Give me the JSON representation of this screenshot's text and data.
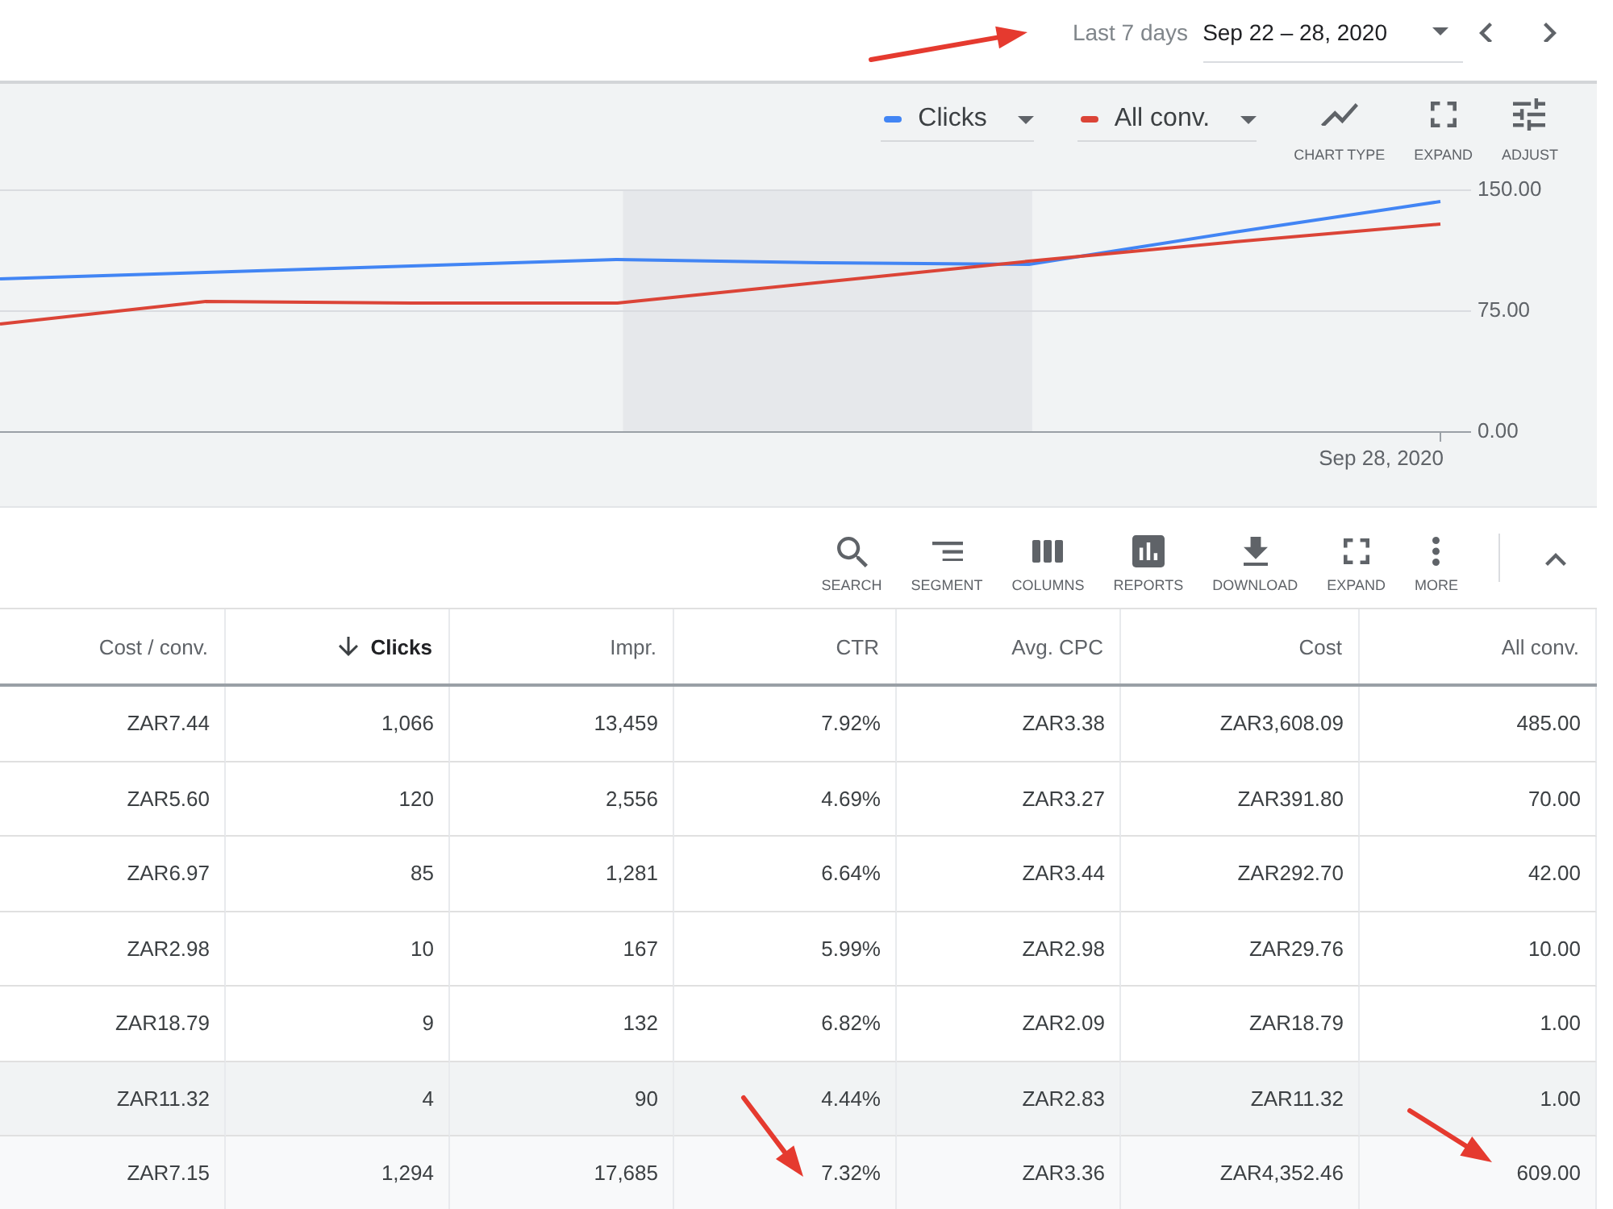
{
  "date_range": {
    "preset": "Last 7 days",
    "value": "Sep 22 – 28, 2020"
  },
  "chart": {
    "actions": [
      "CHART TYPE",
      "EXPAND",
      "ADJUST"
    ],
    "chart_data": {
      "type": "line",
      "ylim": [
        0,
        150
      ],
      "yticks": [
        {
          "value": 0,
          "label": "0.00"
        },
        {
          "value": 75,
          "label": "75.00"
        },
        {
          "value": 150,
          "label": "150.00"
        }
      ],
      "series": [
        {
          "name": "Clicks",
          "color": "#4285f4",
          "values": [
            95,
            99,
            103,
            107,
            105,
            104,
            124,
            143
          ]
        },
        {
          "name": "All conv.",
          "color": "#db4437",
          "values": [
            67,
            81,
            80,
            80,
            93,
            106,
            118,
            129
          ]
        }
      ],
      "annotations": [
        "Sep 28, 2020"
      ]
    }
  },
  "toolbar": {
    "tools": [
      "SEARCH",
      "SEGMENT",
      "COLUMNS",
      "REPORTS",
      "DOWNLOAD",
      "EXPAND",
      "MORE"
    ]
  },
  "table": {
    "columns": [
      {
        "label": "Cost / conv.",
        "sorted": false
      },
      {
        "label": "Clicks",
        "sorted": true
      },
      {
        "label": "Impr.",
        "sorted": false
      },
      {
        "label": "CTR",
        "sorted": false
      },
      {
        "label": "Avg. CPC",
        "sorted": false
      },
      {
        "label": "Cost",
        "sorted": false
      },
      {
        "label": "All conv.",
        "sorted": false
      }
    ],
    "rows": [
      {
        "kind": "data",
        "cells": [
          "ZAR7.44",
          "1,066",
          "13,459",
          "7.92%",
          "ZAR3.38",
          "ZAR3,608.09",
          "485.00"
        ]
      },
      {
        "kind": "data",
        "cells": [
          "ZAR5.60",
          "120",
          "2,556",
          "4.69%",
          "ZAR3.27",
          "ZAR391.80",
          "70.00"
        ]
      },
      {
        "kind": "data",
        "cells": [
          "ZAR6.97",
          "85",
          "1,281",
          "6.64%",
          "ZAR3.44",
          "ZAR292.70",
          "42.00"
        ]
      },
      {
        "kind": "data",
        "cells": [
          "ZAR2.98",
          "10",
          "167",
          "5.99%",
          "ZAR2.98",
          "ZAR29.76",
          "10.00"
        ]
      },
      {
        "kind": "data",
        "cells": [
          "ZAR18.79",
          "9",
          "132",
          "6.82%",
          "ZAR2.09",
          "ZAR18.79",
          "1.00"
        ]
      },
      {
        "kind": "subtotal",
        "cells": [
          "ZAR11.32",
          "4",
          "90",
          "4.44%",
          "ZAR2.83",
          "ZAR11.32",
          "1.00"
        ]
      },
      {
        "kind": "total",
        "cells": [
          "ZAR7.15",
          "1,294",
          "17,685",
          "7.32%",
          "ZAR3.36",
          "ZAR4,352.46",
          "609.00"
        ]
      }
    ]
  }
}
